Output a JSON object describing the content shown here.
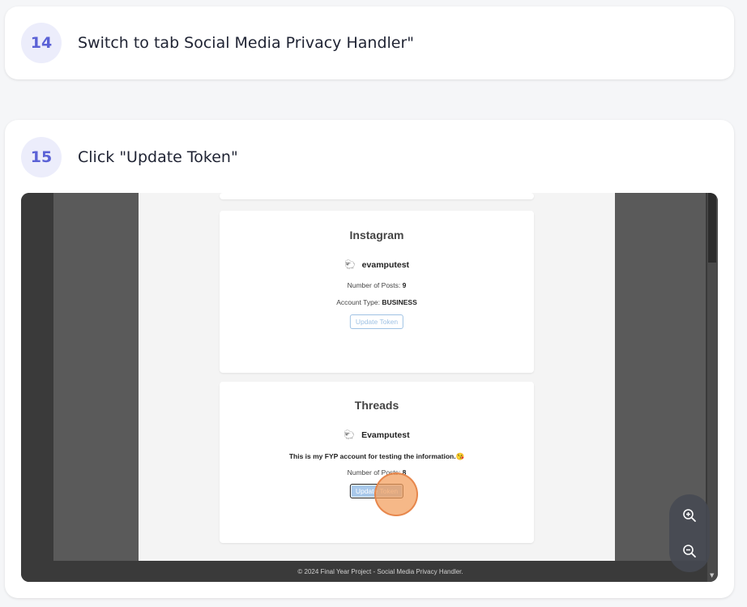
{
  "steps": [
    {
      "number": "14",
      "text": "Switch to tab Social Media Privacy Handler\""
    },
    {
      "number": "15",
      "text": "Click \"Update Token\""
    }
  ],
  "screenshot": {
    "instagram_card": {
      "title": "Instagram",
      "username": "evamputest",
      "posts_label": "Number of Posts:",
      "posts_value": "9",
      "type_label": "Account Type:",
      "type_value": "BUSINESS",
      "button_label": "Update Token"
    },
    "threads_card": {
      "title": "Threads",
      "username": "Evamputest",
      "description": "This is my FYP account for testing the information.😘",
      "posts_label": "Number of Posts:",
      "posts_value": "8",
      "button_label": "Update Token"
    },
    "footer_text": "© 2024 Final Year Project - Social Media Privacy Handler.",
    "avatar_icon": "avatar-icon",
    "zoom_in_icon": "zoom-in-icon",
    "zoom_out_icon": "zoom-out-icon"
  },
  "colors": {
    "badge_bg": "#ecedfb",
    "badge_text": "#5b62d6",
    "click_marker": "#f39c5a",
    "button_outline": "#9fc2e4"
  }
}
